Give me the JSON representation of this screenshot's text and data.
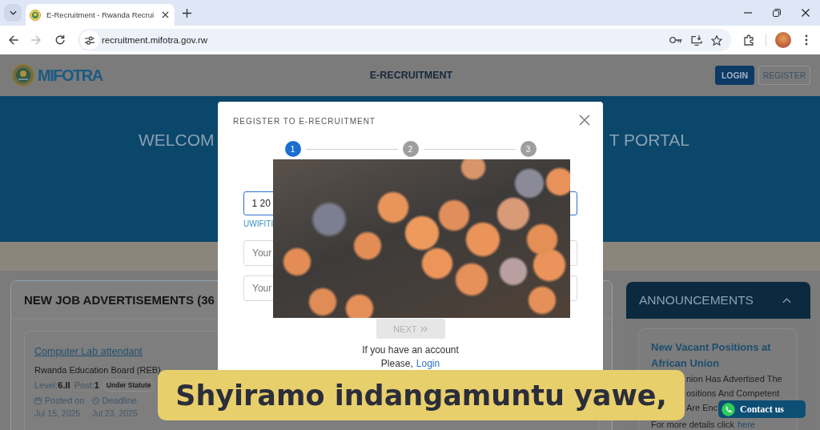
{
  "browser": {
    "tabs": [
      {
        "title": "E-Recruitment - Rwanda Recrui",
        "selected": true
      }
    ],
    "nav_buttons": [
      {
        "kind": "back",
        "disabled": false
      },
      {
        "kind": "forward",
        "disabled": true
      },
      {
        "kind": "reload",
        "disabled": false
      }
    ],
    "url": "recruitment.mifotra.gov.rw"
  },
  "header": {
    "logo": "MIFOTRA",
    "title": "E-RECRUITMENT",
    "buttons": [
      {
        "label": "LOGIN",
        "kind": "login"
      },
      {
        "label": "REGISTER",
        "kind": "register"
      }
    ]
  },
  "hero": {
    "title_start": "WELCOM",
    "title_end": "T PORTAL"
  },
  "jobs": {
    "heading": "NEW JOB ADVERTISEMENTS (36",
    "items": [
      {
        "title": "Computer Lab attendant",
        "employer": "Rwanda Education Board (REB)",
        "grade": "Level:**6.II**",
        "posts": "Post:**1**",
        "tag": "Under Statute",
        "posted_label": "Posted on",
        "posted_date": "Jul 15, 2025",
        "deadline_label": "Deadline",
        "deadline_date": "Jul 23, 2025"
      }
    ]
  },
  "announcements": {
    "heading": "ANNOUNCEMENTS",
    "expanded": true,
    "items": [
      {
        "title": "New Vacant Positions at African Union",
        "body_lines": [
          "nion Has Advertised The",
          "ositions And Competent",
          "Are Enc"
        ],
        "more_text": "For more details click",
        "more_link": "here"
      }
    ]
  },
  "modal": {
    "title": "REGISTER TO E-RECRUITMENT",
    "steps": [
      {
        "number": "1",
        "selected": true
      },
      {
        "number": "2",
        "selected": false
      },
      {
        "number": "3",
        "selected": false
      }
    ],
    "fields": [
      {
        "value": "1 20",
        "focused": true,
        "hint": "UWIFITI"
      },
      {
        "placeholder": "Your",
        "focused": false
      },
      {
        "placeholder": "Your",
        "focused": false
      }
    ],
    "next_button": {
      "label": "NEXT",
      "disabled": true
    },
    "account_prompt": "If you have an account",
    "login_prompt": "Please,",
    "login_link": "Login"
  },
  "caption": {
    "text": "Shyiramo indangamuntu yawe,"
  },
  "contact_button": {
    "label": "Contact us"
  }
}
